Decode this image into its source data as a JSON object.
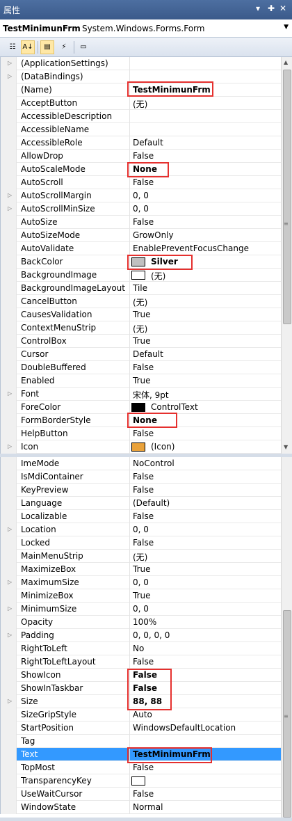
{
  "titlebar": {
    "title": "属性",
    "pin": "▾ ✚ ✕"
  },
  "object_selector": {
    "name": "TestMinimunFrm",
    "type": "System.Windows.Forms.Form"
  },
  "toolbar": {
    "icons": [
      "categorized-icon",
      "alphabetical-icon",
      "properties-icon",
      "events-icon",
      "property-pages-icon"
    ]
  },
  "grid_top": [
    {
      "name": "(ApplicationSettings)",
      "value": "",
      "expand": true
    },
    {
      "name": "(DataBindings)",
      "value": "",
      "expand": true
    },
    {
      "name": "(Name)",
      "value": "TestMinimunFrm",
      "bold": true
    },
    {
      "name": "AcceptButton",
      "value": "(无)"
    },
    {
      "name": "AccessibleDescription",
      "value": ""
    },
    {
      "name": "AccessibleName",
      "value": ""
    },
    {
      "name": "AccessibleRole",
      "value": "Default"
    },
    {
      "name": "AllowDrop",
      "value": "False"
    },
    {
      "name": "AutoScaleMode",
      "value": "None",
      "bold": true
    },
    {
      "name": "AutoScroll",
      "value": "False"
    },
    {
      "name": "AutoScrollMargin",
      "value": "0, 0",
      "expand": true
    },
    {
      "name": "AutoScrollMinSize",
      "value": "0, 0",
      "expand": true
    },
    {
      "name": "AutoSize",
      "value": "False"
    },
    {
      "name": "AutoSizeMode",
      "value": "GrowOnly"
    },
    {
      "name": "AutoValidate",
      "value": "EnablePreventFocusChange"
    },
    {
      "name": "BackColor",
      "value": "Silver",
      "bold": true,
      "swatch": "#c0c0c0"
    },
    {
      "name": "BackgroundImage",
      "value": "(无)",
      "swatch": "#ffffff"
    },
    {
      "name": "BackgroundImageLayout",
      "value": "Tile"
    },
    {
      "name": "CancelButton",
      "value": "(无)"
    },
    {
      "name": "CausesValidation",
      "value": "True"
    },
    {
      "name": "ContextMenuStrip",
      "value": "(无)"
    },
    {
      "name": "ControlBox",
      "value": "True"
    },
    {
      "name": "Cursor",
      "value": "Default"
    },
    {
      "name": "DoubleBuffered",
      "value": "False"
    },
    {
      "name": "Enabled",
      "value": "True"
    },
    {
      "name": "Font",
      "value": "宋体, 9pt",
      "expand": true
    },
    {
      "name": "ForeColor",
      "value": "ControlText",
      "swatch": "#000000"
    },
    {
      "name": "FormBorderStyle",
      "value": "None",
      "bold": true
    },
    {
      "name": "HelpButton",
      "value": "False"
    },
    {
      "name": "Icon",
      "value": "(Icon)",
      "expand": true,
      "swatch": "#e9a23b"
    }
  ],
  "grid_bottom": [
    {
      "name": "ImeMode",
      "value": "NoControl"
    },
    {
      "name": "IsMdiContainer",
      "value": "False"
    },
    {
      "name": "KeyPreview",
      "value": "False"
    },
    {
      "name": "Language",
      "value": "(Default)"
    },
    {
      "name": "Localizable",
      "value": "False"
    },
    {
      "name": "Location",
      "value": "0, 0",
      "expand": true
    },
    {
      "name": "Locked",
      "value": "False"
    },
    {
      "name": "MainMenuStrip",
      "value": "(无)"
    },
    {
      "name": "MaximizeBox",
      "value": "True"
    },
    {
      "name": "MaximumSize",
      "value": "0, 0",
      "expand": true
    },
    {
      "name": "MinimizeBox",
      "value": "True"
    },
    {
      "name": "MinimumSize",
      "value": "0, 0",
      "expand": true
    },
    {
      "name": "Opacity",
      "value": "100%"
    },
    {
      "name": "Padding",
      "value": "0, 0, 0, 0",
      "expand": true
    },
    {
      "name": "RightToLeft",
      "value": "No"
    },
    {
      "name": "RightToLeftLayout",
      "value": "False"
    },
    {
      "name": "ShowIcon",
      "value": "False",
      "bold": true
    },
    {
      "name": "ShowInTaskbar",
      "value": "False",
      "bold": true
    },
    {
      "name": "Size",
      "value": "88, 88",
      "bold": true,
      "expand": true
    },
    {
      "name": "SizeGripStyle",
      "value": "Auto"
    },
    {
      "name": "StartPosition",
      "value": "WindowsDefaultLocation"
    },
    {
      "name": "Tag",
      "value": ""
    },
    {
      "name": "Text",
      "value": "TestMinimunFrm",
      "bold": true,
      "selected": true
    },
    {
      "name": "TopMost",
      "value": "False"
    },
    {
      "name": "TransparencyKey",
      "value": "",
      "swatch": "#ffffff"
    },
    {
      "name": "UseWaitCursor",
      "value": "False"
    },
    {
      "name": "WindowState",
      "value": "Normal"
    }
  ],
  "colors": {
    "highlight": "#e5302e",
    "selected_row": "#3399ff",
    "title_bar": "#4d6fa1"
  }
}
